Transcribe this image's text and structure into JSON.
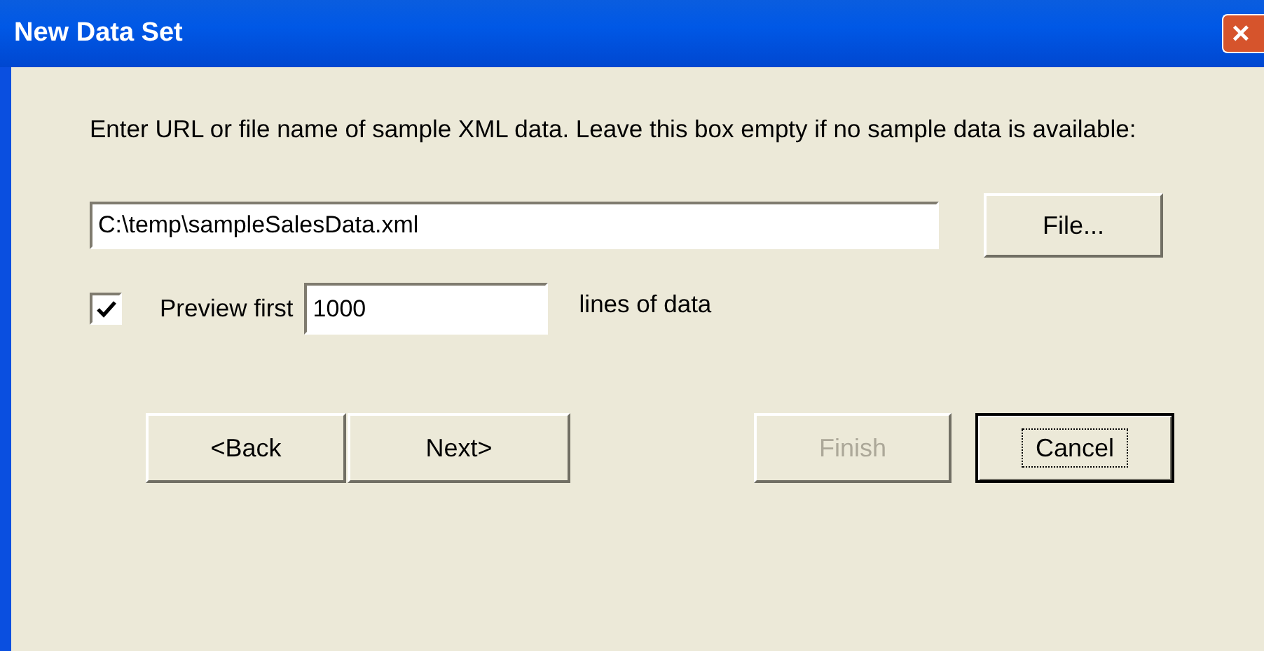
{
  "window": {
    "title": "New Data Set",
    "close": "×"
  },
  "prompt": "Enter URL or file name of sample XML data. Leave this box empty if no sample data is available:",
  "source": {
    "value": "C:\\temp\\sampleSalesData.xml",
    "button": "File..."
  },
  "preview": {
    "checked": true,
    "label": "Preview first",
    "value": "1000",
    "suffix": "lines of data"
  },
  "buttons": [
    {
      "label": "<Back",
      "disabled": false,
      "focused": false
    },
    {
      "label": "Next>",
      "disabled": false,
      "focused": false
    },
    {
      "label": "Finish",
      "disabled": true,
      "focused": false
    },
    {
      "label": "Cancel",
      "disabled": false,
      "focused": true
    }
  ]
}
